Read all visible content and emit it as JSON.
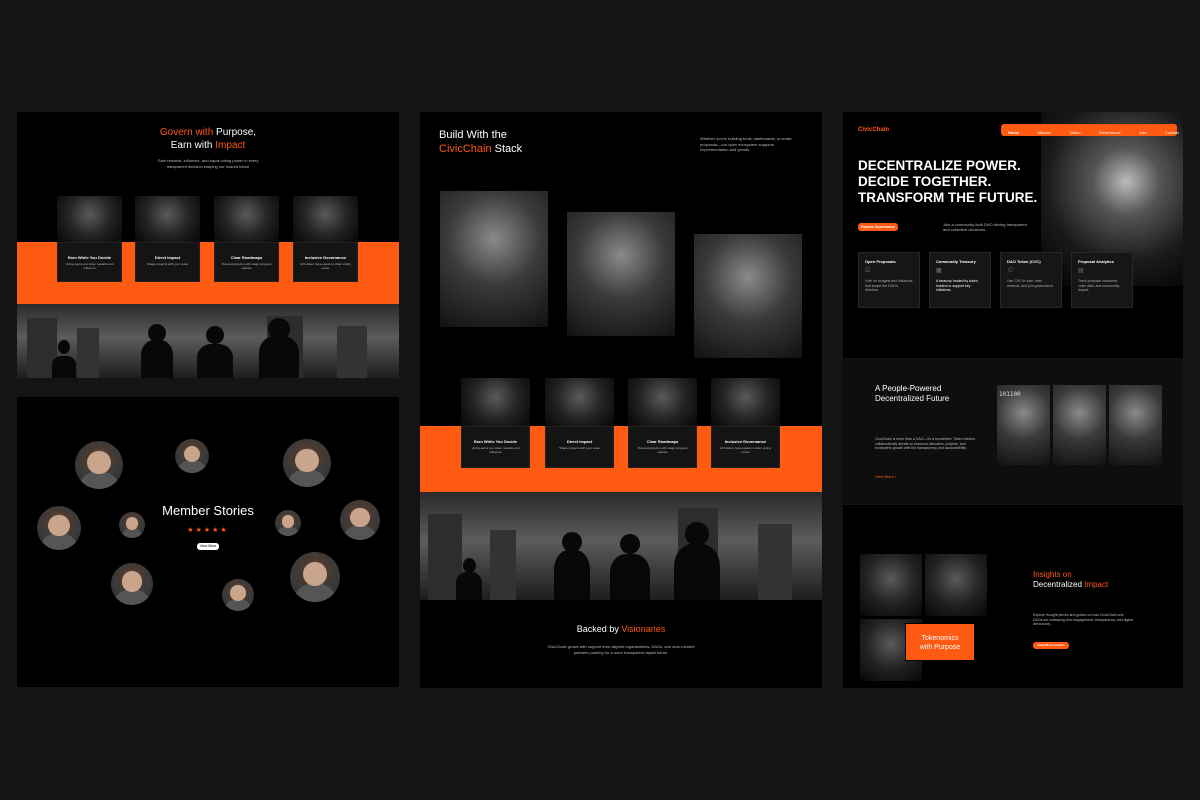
{
  "panel1": {
    "title_a": "Govern with",
    "title_b": "Purpose,",
    "title_c": "Earn with",
    "title_d": "Impact",
    "subtitle": "Gain rewards, influence, and equal voting power in every transparent decision shaping our shared future",
    "cards": [
      {
        "title": "Earn While You Decide",
        "desc": "Voting earns you token rewards and influence"
      },
      {
        "title": "Direct Impact",
        "desc": "Shape projects with your votes"
      },
      {
        "title": "Clear Roadmaps",
        "desc": "Proposal pipeline with stage progress updates"
      },
      {
        "title": "Inclusive Governance",
        "desc": "All holders have equal on-chain voting power"
      }
    ]
  },
  "panel2": {
    "title": "Member Stories",
    "stars": "★★★★★",
    "button": "View More"
  },
  "panel3": {
    "title_a": "Build With the",
    "title_b": "CivicChain",
    "title_c": "Stack",
    "intro": "Whether you're building tools, dashboards, or smart proposals—our open ecosystem supports experimentation and growth.",
    "cards": [
      {
        "title": "Earn While You Decide",
        "desc": "Voting earns you token rewards and influence"
      },
      {
        "title": "Direct Impact",
        "desc": "Shape projects with your votes"
      },
      {
        "title": "Clear Roadmaps",
        "desc": "Proposal pipeline with stage progress updates"
      },
      {
        "title": "Inclusive Governance",
        "desc": "All holders have equal on-chain voting power"
      }
    ],
    "backed_a": "Backed by",
    "backed_b": "Visionaries",
    "backed_desc": "CivicChain grows with support from aligned organizations, DAOs, and civic-minded partners pushing for a more transparent digital future."
  },
  "panel4": {
    "logo": "CivicChain",
    "nav": [
      "Home",
      "Mission",
      "Vision",
      "Governance",
      "Join",
      "Contact"
    ],
    "hero_line1": "DECENTRALIZE POWER.",
    "hero_line2": "DECIDE TOGETHER.",
    "hero_line3": "TRANSFORM THE FUTURE.",
    "hero_button": "Explore Governance",
    "hero_side": "Join a community-built DAO driving transparent and collective decisions.",
    "features": [
      {
        "title": "Open Proposals",
        "desc": "Vote on budgets and initiatives that shape the DAO's direction."
      },
      {
        "title": "Community Treasury",
        "desc": "A treasury funded by token holders to support key initiatives."
      },
      {
        "title": "DAO Token (CVC)",
        "desc": "Use CVC to vote, earn rewards, and join governance."
      },
      {
        "title": "Proposal Analytics",
        "desc": "Track proposal outcomes, voter data, and community impact."
      }
    ]
  },
  "panel5": {
    "title_line1": "A People-Powered",
    "title_line2": "Decentralized Future",
    "desc": "CivicChain is more than a DAO—it's a movement. Token holders collaboratively decide on resource allocation, projects, and ecosystem growth with full transparency and accountability.",
    "link": "View More",
    "binary": "101100"
  },
  "panel6": {
    "title_a": "Insights on",
    "title_b": "Decentralized",
    "title_c": "Impact",
    "desc": "Explore thought pieces and guides on how CivicChain and DAOs are reshaping civic engagement, transparency, and digital democracy.",
    "button": "Read More Articles",
    "overlay_line1": "Tokenomics",
    "overlay_line2": "with Purpose"
  },
  "colors": {
    "accent": "#ff5a12",
    "background": "#141417",
    "panel": "#000000"
  }
}
